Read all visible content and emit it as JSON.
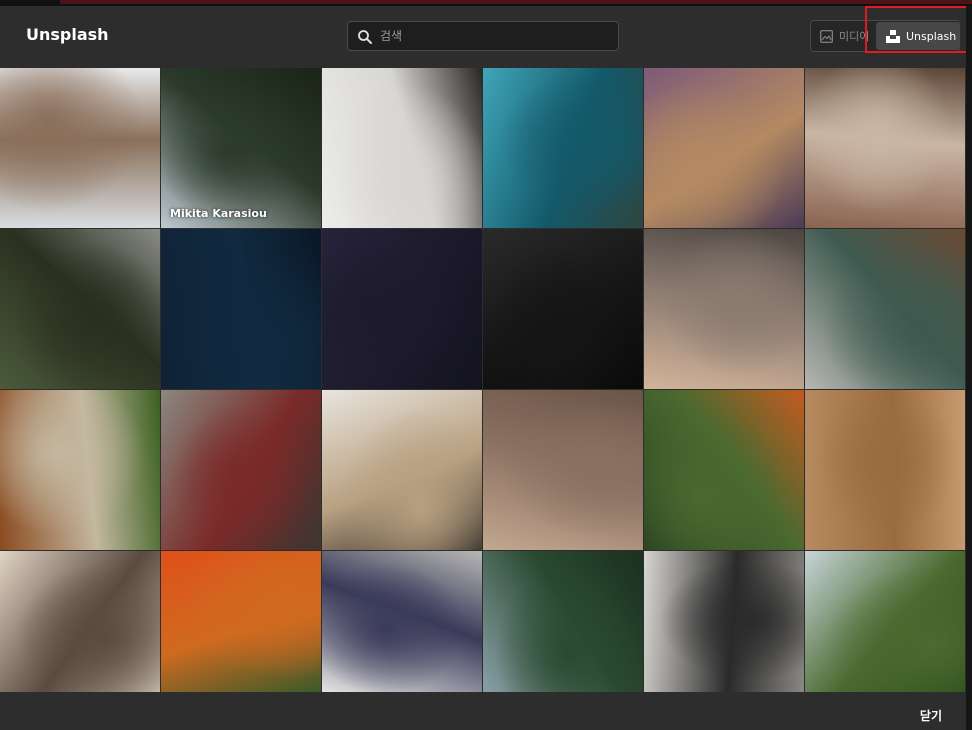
{
  "dialog": {
    "title": "Unsplash",
    "search": {
      "placeholder": "검색",
      "value": ""
    },
    "source_tabs": [
      {
        "label": "미디어",
        "icon": "image-icon",
        "selected": false
      },
      {
        "label": "Unsplash",
        "icon": "unsplash-logo-icon",
        "selected": true
      }
    ],
    "close_label": "닫기"
  },
  "photos": [
    {
      "subject": "laptop-on-desk",
      "credit": "",
      "colors": [
        "#d8dde0",
        "#8a6f5a",
        "#e9eaec"
      ]
    },
    {
      "subject": "pine-forest-mountain",
      "credit": "Mikita Karasiou",
      "colors": [
        "#bfcad2",
        "#2b3a2a",
        "#1a2418"
      ]
    },
    {
      "subject": "photo-studio-people",
      "credit": "",
      "colors": [
        "#ececea",
        "#d8d6d2",
        "#2a2624"
      ]
    },
    {
      "subject": "underwater-reef",
      "credit": "",
      "colors": [
        "#3fa6b8",
        "#13596a",
        "#2e4640"
      ]
    },
    {
      "subject": "purple-texture",
      "credit": "",
      "colors": [
        "#7d5a78",
        "#b48a62",
        "#4a3a55"
      ]
    },
    {
      "subject": "penguins",
      "credit": "",
      "colors": [
        "#8a6250",
        "#c9b6a4",
        "#5a4436"
      ]
    },
    {
      "subject": "vintage-car-trees",
      "credit": "",
      "colors": [
        "#4a5a3a",
        "#2a3020",
        "#8a8c86"
      ]
    },
    {
      "subject": "jellyfish-dark",
      "credit": "",
      "colors": [
        "#0f2236",
        "#112a40",
        "#0a1828"
      ]
    },
    {
      "subject": "night-sky",
      "credit": "",
      "colors": [
        "#26233a",
        "#1c1a2c",
        "#141320"
      ]
    },
    {
      "subject": "motorcycle-engine",
      "credit": "",
      "colors": [
        "#2a2a2a",
        "#151515",
        "#0a0a0a"
      ]
    },
    {
      "subject": "motorcycle-road-sunset",
      "credit": "",
      "colors": [
        "#d4b49a",
        "#8a7a70",
        "#4a4440"
      ]
    },
    {
      "subject": "woman-in-hat",
      "credit": "",
      "colors": [
        "#b9b7b2",
        "#3e5a50",
        "#6a4a34"
      ]
    },
    {
      "subject": "salad-bowl",
      "credit": "",
      "colors": [
        "#8a4a20",
        "#c4b8a0",
        "#3a6020"
      ]
    },
    {
      "subject": "red-car-street",
      "credit": "",
      "colors": [
        "#8a8880",
        "#7a2a28",
        "#3a3632"
      ]
    },
    {
      "subject": "woman-rooftop",
      "credit": "",
      "colors": [
        "#e8e4de",
        "#b8a080",
        "#2a2624"
      ]
    },
    {
      "subject": "church-valley",
      "credit": "",
      "colors": [
        "#c2a890",
        "#8a7060",
        "#6a5448"
      ]
    },
    {
      "subject": "woman-in-leaves",
      "credit": "",
      "colors": [
        "#2a4020",
        "#4a6a30",
        "#c45a20"
      ]
    },
    {
      "subject": "desert-aerial",
      "credit": "",
      "colors": [
        "#b88a60",
        "#9a6a40",
        "#c89a70"
      ]
    },
    {
      "subject": "woman-sneakers-bridge",
      "credit": "",
      "colors": [
        "#e0d4c4",
        "#5a4a40",
        "#c4b8a8"
      ]
    },
    {
      "subject": "cactus-orange-sky",
      "credit": "",
      "colors": [
        "#e0501a",
        "#d06a20",
        "#3a5a2a"
      ]
    },
    {
      "subject": "keyboard-desk",
      "credit": "",
      "colors": [
        "#e4e4e2",
        "#3a3a5a",
        "#b8b8b6"
      ]
    },
    {
      "subject": "mountain-forest-river",
      "credit": "",
      "colors": [
        "#8aa0a8",
        "#2a4a30",
        "#1a3020"
      ]
    },
    {
      "subject": "photographer-studio",
      "credit": "",
      "colors": [
        "#d8d6d2",
        "#2a2a2a",
        "#8a8884"
      ]
    },
    {
      "subject": "palm-trees-path",
      "credit": "",
      "colors": [
        "#c8d4d8",
        "#4a6a30",
        "#2a4a1a"
      ]
    }
  ]
}
